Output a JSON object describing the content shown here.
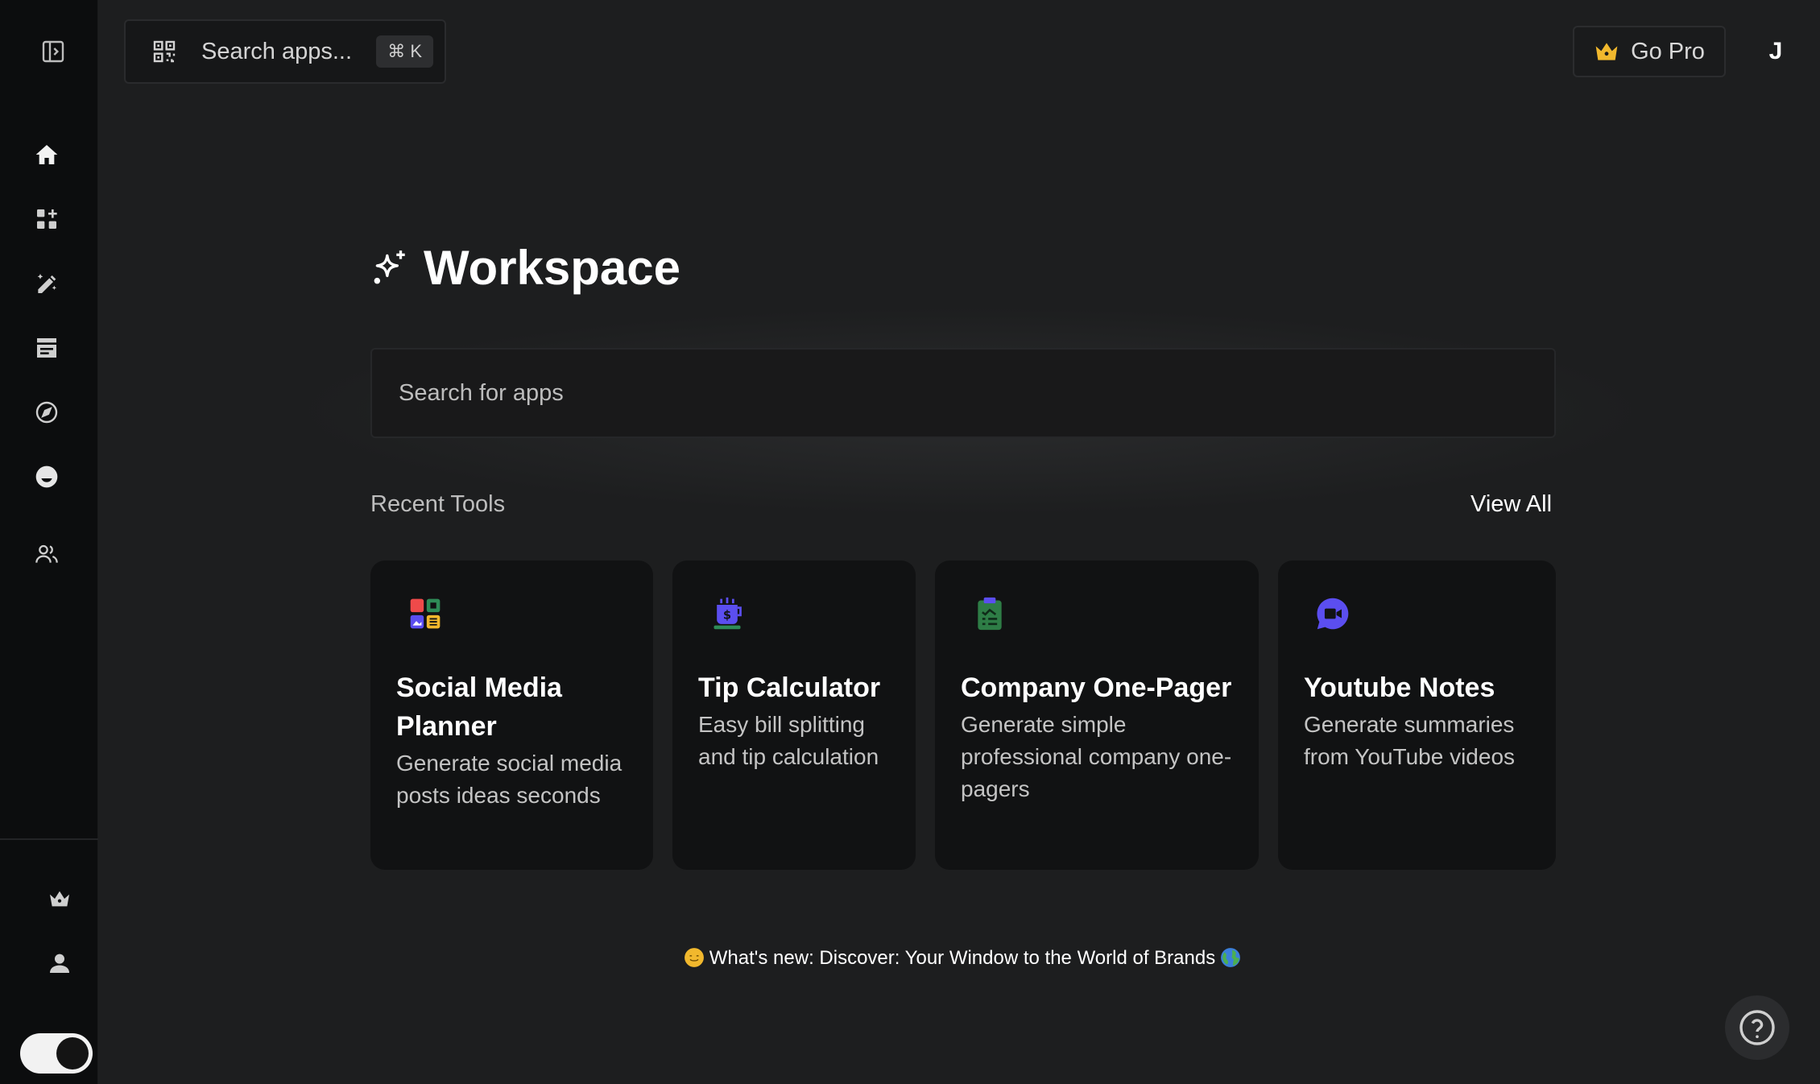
{
  "topbar": {
    "search_placeholder": "Search apps...",
    "shortcut": "⌘ K",
    "go_pro_label": "Go Pro",
    "avatar_initial": "J"
  },
  "sidebar": {
    "items": [
      {
        "icon": "panel-toggle-icon"
      },
      {
        "icon": "home-icon"
      },
      {
        "icon": "apps-add-icon"
      },
      {
        "icon": "edit-sparkle-icon"
      },
      {
        "icon": "article-icon"
      },
      {
        "icon": "compass-icon"
      },
      {
        "icon": "face-icon"
      },
      {
        "icon": "users-icon"
      },
      {
        "icon": "crown-icon"
      },
      {
        "icon": "person-icon"
      }
    ],
    "theme_toggle": "dark"
  },
  "main": {
    "title": "Workspace",
    "search_placeholder": "Search for apps",
    "recent_label": "Recent Tools",
    "view_all_label": "View All",
    "cards": [
      {
        "title": "Social Media Planner",
        "description": "Generate social media posts ideas seconds",
        "icon": "social-media-icon"
      },
      {
        "title": "Tip Calculator",
        "description": "Easy bill splitting and tip calculation",
        "icon": "tip-calculator-icon"
      },
      {
        "title": "Company One-Pager",
        "description": "Generate simple professional company one-pagers",
        "icon": "clipboard-icon"
      },
      {
        "title": "Youtube Notes",
        "description": "Generate summaries from YouTube videos",
        "icon": "video-chat-icon"
      }
    ],
    "whats_new": "What's new: Discover: Your Window to the World of Brands"
  },
  "colors": {
    "background": "#1d1e1f",
    "sidebar": "#0c0d0e",
    "card": "#111213",
    "crown_gold": "#f1b82d",
    "accent_purple": "#5b4ef0",
    "accent_green": "#2e7d46"
  }
}
